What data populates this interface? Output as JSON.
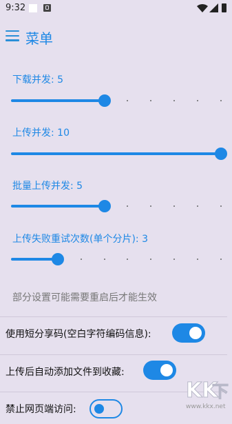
{
  "status_bar": {
    "time": "9:32",
    "icons": [
      "notification-icon",
      "app-icon",
      "wifi-icon",
      "cellular-icon",
      "battery-icon"
    ]
  },
  "app_bar": {
    "title": "菜单",
    "menu_icon": "hamburger-icon"
  },
  "sliders": [
    {
      "label": "下载并发: 5",
      "value": 5,
      "min": 1,
      "max": 10
    },
    {
      "label": "上传并发: 10",
      "value": 10,
      "min": 1,
      "max": 10
    },
    {
      "label": "批量上传并发: 5",
      "value": 5,
      "min": 1,
      "max": 10
    },
    {
      "label": "上传失败重试次数(单个分片): 3",
      "value": 3,
      "min": 1,
      "max": 10
    }
  ],
  "note": "部分设置可能需要重启后才能生效",
  "switches": [
    {
      "label": "使用短分享码(空白字符编码信息):",
      "on": true
    },
    {
      "label": "上传后自动添加文件到收藏:",
      "on": true
    },
    {
      "label": "禁止网页端访问:",
      "on": false
    }
  ],
  "watermark": {
    "logo": "KK下载",
    "url": "www.kkx.net"
  },
  "colors": {
    "accent": "#1e88e5",
    "background": "#e6e0ee"
  }
}
